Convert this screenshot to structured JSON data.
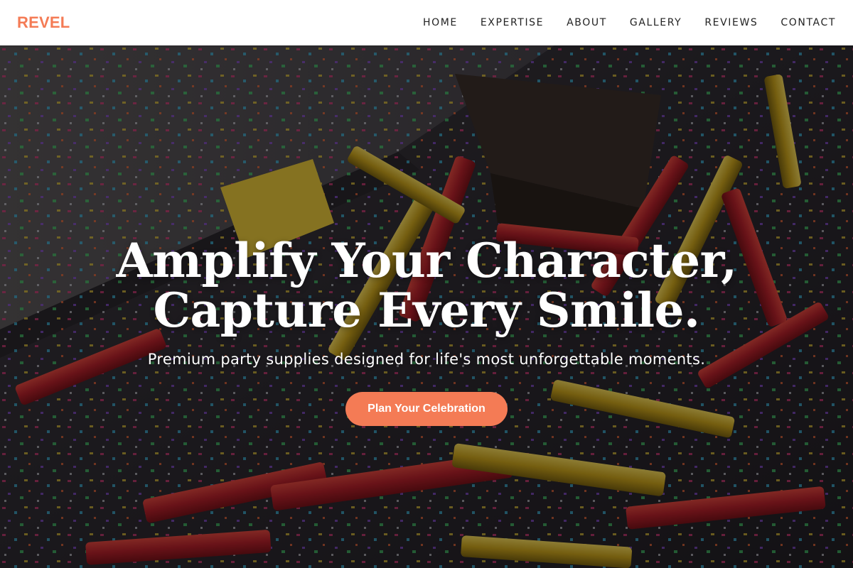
{
  "brand": {
    "name": "REVEL",
    "accent_color": "#F47B55"
  },
  "nav": {
    "items": [
      {
        "label": "HOME"
      },
      {
        "label": "EXPERTISE"
      },
      {
        "label": "ABOUT"
      },
      {
        "label": "GALLERY"
      },
      {
        "label": "REVIEWS"
      },
      {
        "label": "CONTACT"
      }
    ]
  },
  "hero": {
    "headline_line1": "Amplify Your Character,",
    "headline_line2": "Capture Every Smile.",
    "subtitle": "Premium party supplies designed for life's most unforgettable moments.",
    "cta_label": "Plan Your Celebration",
    "cta_color": "#F47B55",
    "background": "photo of spent party popper tubes and confetti on pavement"
  }
}
